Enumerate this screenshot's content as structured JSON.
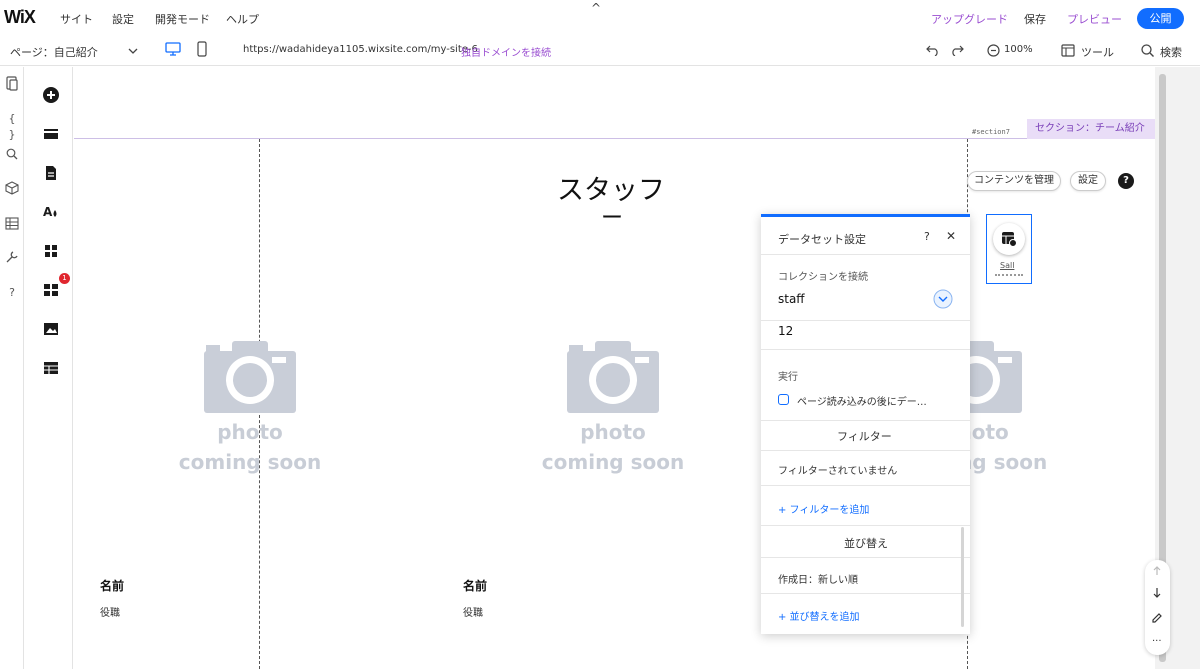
{
  "topbar": {
    "logo": "WiX",
    "menu": [
      "サイト",
      "設定",
      "開発モード",
      "ヘルプ"
    ],
    "upgrade": "アップグレード",
    "save": "保存",
    "preview": "プレビュー",
    "publish": "公開",
    "caret": "^"
  },
  "subbar": {
    "page_select": "ページ：自己紹介",
    "url": "https://wadahideya1105.wixsite.com/my-site-6",
    "connect_domain": "独自ドメインを接続",
    "zoom": "100%",
    "tools": "ツール",
    "search": "検索"
  },
  "rail2": {
    "badge": "1"
  },
  "canvas": {
    "section_id": "#section7",
    "section_label": "セクション：チーム紹介",
    "title": "スタッフ",
    "title_dash": "ー",
    "manage_content": "コンテンツを管理",
    "settings": "設定",
    "help": "?",
    "photo_line1": "photo",
    "photo_line2": "coming soon",
    "cards": [
      {
        "name": "名前",
        "role": "役職"
      },
      {
        "name": "名前",
        "role": "役職"
      }
    ],
    "dataset_icon_label": "Sall"
  },
  "panel": {
    "title": "データセット設定",
    "help": "?",
    "close": "✕",
    "collection_label": "コレクションを接続",
    "collection_value": "staff",
    "count": "12",
    "run_label": "実行",
    "run_checkbox": "ページ読み込みの後にデー…",
    "filter_heading": "フィルター",
    "filter_none": "フィルターされていません",
    "add_filter": "+ フィルターを追加",
    "sort_heading": "並び替え",
    "sort_value": "作成日：新しい順",
    "add_sort": "+ 並び替えを追加"
  },
  "colors": {
    "accent_blue": "#116dff",
    "purple": "#9a4ed1",
    "arrow_red": "#e8141b",
    "badge_red": "#e0262f"
  }
}
